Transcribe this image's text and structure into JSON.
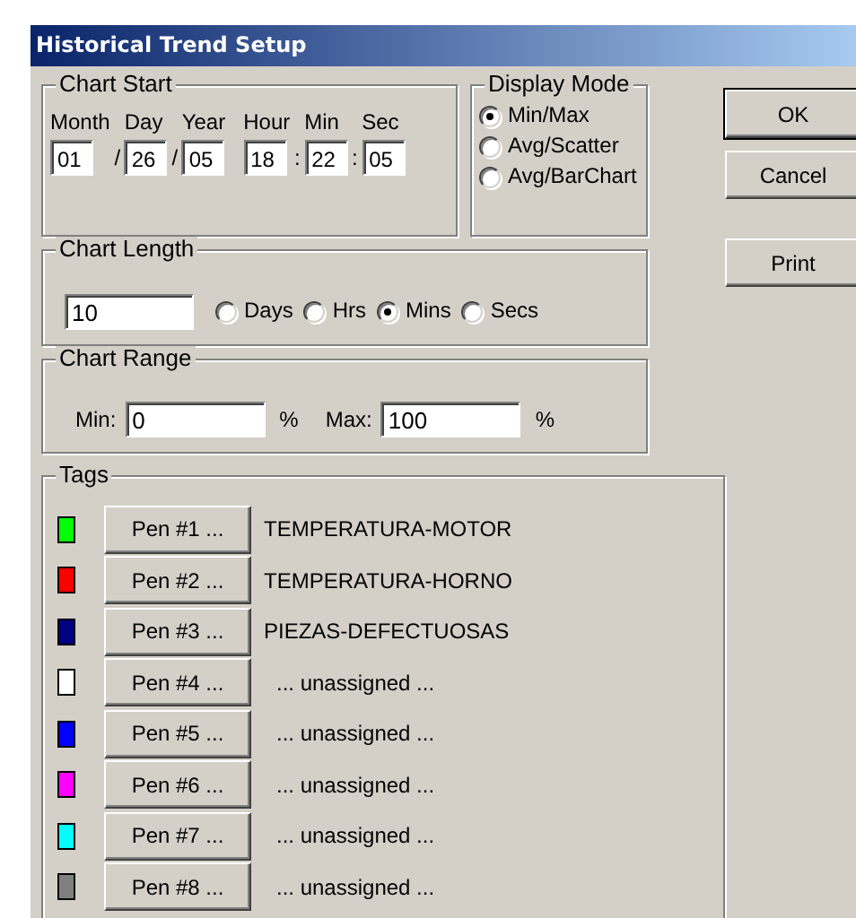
{
  "window": {
    "title": "Historical Trend Setup"
  },
  "chart_start": {
    "title": "Chart Start",
    "fields": [
      {
        "label": "Month",
        "value": "01",
        "separator": "/"
      },
      {
        "label": "Day",
        "value": "26",
        "separator": "/"
      },
      {
        "label": "Year",
        "value": "05"
      },
      {
        "label": "Hour",
        "value": "18",
        "separator": ":"
      },
      {
        "label": "Min",
        "value": "22",
        "separator": ":"
      },
      {
        "label": "Sec",
        "value": "05"
      }
    ]
  },
  "display_mode": {
    "title": "Display Mode",
    "options": [
      {
        "label": "Min/Max",
        "selected": true
      },
      {
        "label": "Avg/Scatter",
        "selected": false
      },
      {
        "label": "Avg/BarChart",
        "selected": false
      }
    ]
  },
  "buttons": [
    {
      "label": "OK",
      "default": true
    },
    {
      "label": "Cancel",
      "default": false
    },
    {
      "label": "Print",
      "default": false
    }
  ],
  "chart_length": {
    "title": "Chart Length",
    "value": "10",
    "units": [
      {
        "label": "Days",
        "selected": false
      },
      {
        "label": "Hrs",
        "selected": false
      },
      {
        "label": "Mins",
        "selected": true
      },
      {
        "label": "Secs",
        "selected": false
      }
    ]
  },
  "chart_range": {
    "title": "Chart Range",
    "min_label": "Min:",
    "min_value": "0",
    "min_unit": "%",
    "max_label": "Max:",
    "max_value": "100",
    "max_unit": "%"
  },
  "tags": {
    "title": "Tags",
    "pens": [
      {
        "color": "#00ff00",
        "button": "Pen #1 ...",
        "tag": "TEMPERATURA-MOTOR"
      },
      {
        "color": "#ff0000",
        "button": "Pen #2 ...",
        "tag": "TEMPERATURA-HORNO"
      },
      {
        "color": "#000080",
        "button": "Pen #3 ...",
        "tag": "PIEZAS-DEFECTUOSAS"
      },
      {
        "color": "#ffffff",
        "button": "Pen #4 ...",
        "tag": "... unassigned ..."
      },
      {
        "color": "#0000ff",
        "button": "Pen #5 ...",
        "tag": "... unassigned ..."
      },
      {
        "color": "#ff00ff",
        "button": "Pen #6 ...",
        "tag": "... unassigned ..."
      },
      {
        "color": "#00ffff",
        "button": "Pen #7 ...",
        "tag": "... unassigned ..."
      },
      {
        "color": "#808080",
        "button": "Pen #8 ...",
        "tag": "... unassigned ..."
      }
    ]
  }
}
